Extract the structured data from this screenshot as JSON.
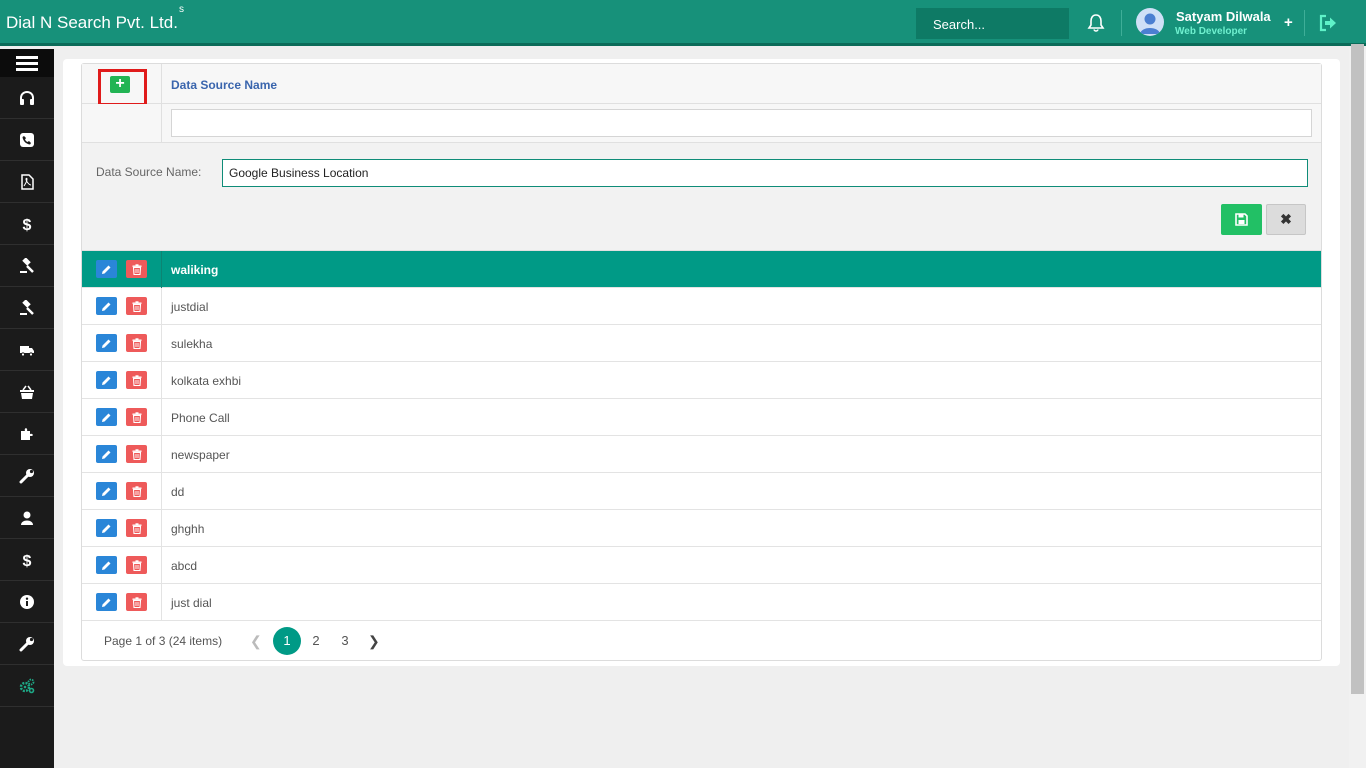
{
  "app": {
    "brand": "Dial N Search Pvt. Ltd.",
    "brand_sup": "s",
    "search_placeholder": "Search...",
    "user_name": "Satyam Dilwala",
    "user_role": "Web Developer"
  },
  "sidebar": {
    "items": [
      {
        "icon": "headset-icon"
      },
      {
        "icon": "phone-icon"
      },
      {
        "icon": "pdf-file-icon"
      },
      {
        "icon": "dollar-icon"
      },
      {
        "icon": "gavel-icon"
      },
      {
        "icon": "gavel-icon"
      },
      {
        "icon": "truck-icon"
      },
      {
        "icon": "basket-icon"
      },
      {
        "icon": "puzzle-icon"
      },
      {
        "icon": "wrench-icon"
      },
      {
        "icon": "user-icon"
      },
      {
        "icon": "dollar-icon"
      },
      {
        "icon": "info-icon"
      },
      {
        "icon": "wrench-icon"
      },
      {
        "icon": "cogs-icon",
        "color": "#1ea886"
      }
    ]
  },
  "grid": {
    "column_title": "Data Source Name",
    "filter_value": "",
    "form": {
      "label": "Data Source Name:",
      "value": "Google Business Location"
    },
    "cancel_label": "✖",
    "rows": [
      {
        "name": "waliking",
        "selected": true
      },
      {
        "name": "justdial",
        "selected": false
      },
      {
        "name": "sulekha",
        "selected": false
      },
      {
        "name": "kolkata exhbi",
        "selected": false
      },
      {
        "name": "Phone Call",
        "selected": false
      },
      {
        "name": "newspaper",
        "selected": false
      },
      {
        "name": "dd",
        "selected": false
      },
      {
        "name": "ghghh",
        "selected": false
      },
      {
        "name": "abcd",
        "selected": false
      },
      {
        "name": "just dial",
        "selected": false
      }
    ],
    "pager": {
      "info": "Page 1 of 3 (24 items)",
      "pages": [
        "1",
        "2",
        "3"
      ],
      "current": "1"
    }
  },
  "colors": {
    "accent": "#17917a",
    "selected_row": "#009a86",
    "add_button": "#22b454",
    "edit_button": "#2a86d8",
    "delete_button": "#ee5a5a"
  }
}
